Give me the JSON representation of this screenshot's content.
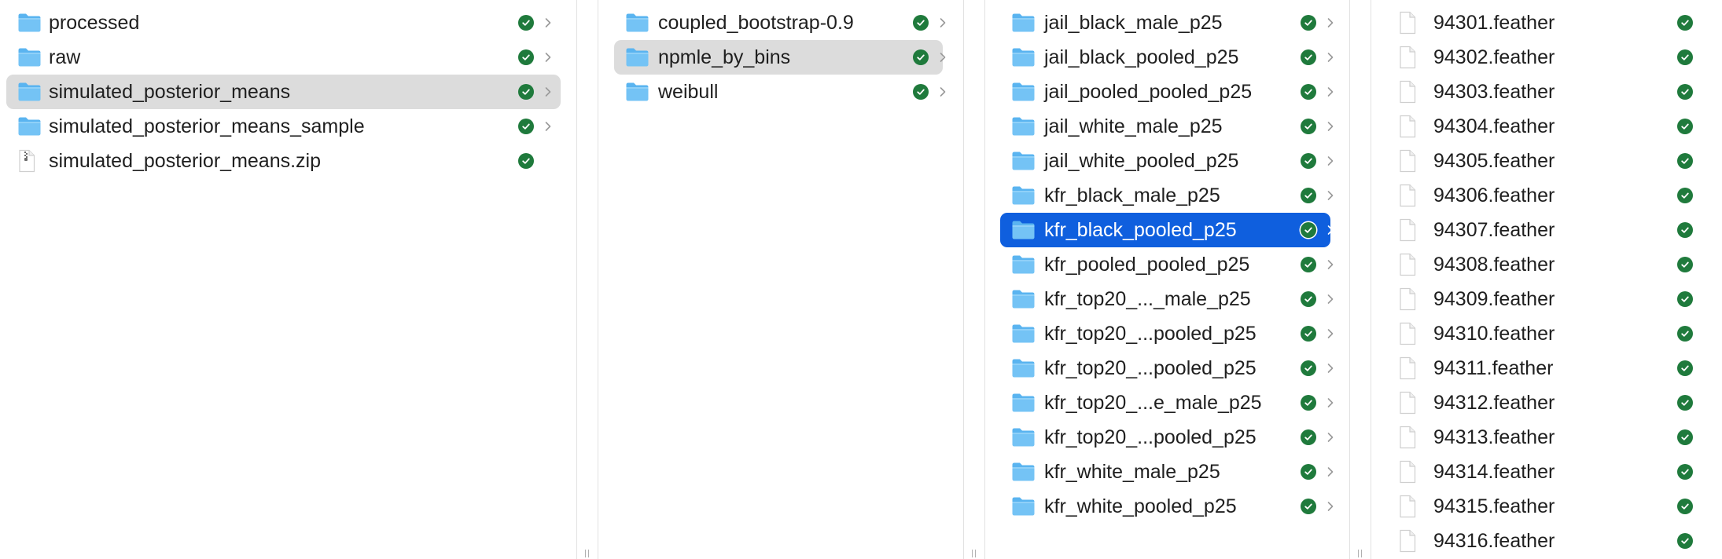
{
  "columns": [
    {
      "items": [
        {
          "label": "processed",
          "type": "folder",
          "state": "normal",
          "icon": "folder-icon",
          "status": "synced"
        },
        {
          "label": "raw",
          "type": "folder",
          "state": "normal",
          "icon": "folder-icon",
          "status": "synced"
        },
        {
          "label": "simulated_posterior_means",
          "type": "folder",
          "state": "highlighted",
          "icon": "folder-icon",
          "status": "synced"
        },
        {
          "label": "simulated_posterior_means_sample",
          "type": "folder",
          "state": "normal",
          "icon": "folder-icon",
          "status": "synced"
        },
        {
          "label": "simulated_posterior_means.zip",
          "type": "zip",
          "state": "normal",
          "icon": "zip-file-icon",
          "status": "synced"
        }
      ]
    },
    {
      "items": [
        {
          "label": "coupled_bootstrap-0.9",
          "type": "folder",
          "state": "normal",
          "icon": "folder-icon",
          "status": "synced"
        },
        {
          "label": "npmle_by_bins",
          "type": "folder",
          "state": "highlighted",
          "icon": "folder-icon",
          "status": "synced"
        },
        {
          "label": "weibull",
          "type": "folder",
          "state": "normal",
          "icon": "folder-icon",
          "status": "synced"
        }
      ]
    },
    {
      "items": [
        {
          "label": "jail_black_male_p25",
          "type": "folder",
          "state": "normal",
          "icon": "folder-icon",
          "status": "synced"
        },
        {
          "label": "jail_black_pooled_p25",
          "type": "folder",
          "state": "normal",
          "icon": "folder-icon",
          "status": "synced"
        },
        {
          "label": "jail_pooled_pooled_p25",
          "type": "folder",
          "state": "normal",
          "icon": "folder-icon",
          "status": "synced"
        },
        {
          "label": "jail_white_male_p25",
          "type": "folder",
          "state": "normal",
          "icon": "folder-icon",
          "status": "synced"
        },
        {
          "label": "jail_white_pooled_p25",
          "type": "folder",
          "state": "normal",
          "icon": "folder-icon",
          "status": "synced"
        },
        {
          "label": "kfr_black_male_p25",
          "type": "folder",
          "state": "normal",
          "icon": "folder-icon",
          "status": "synced"
        },
        {
          "label": "kfr_black_pooled_p25",
          "type": "folder",
          "state": "selected",
          "icon": "folder-icon",
          "status": "synced"
        },
        {
          "label": "kfr_pooled_pooled_p25",
          "type": "folder",
          "state": "normal",
          "icon": "folder-icon",
          "status": "synced"
        },
        {
          "label": "kfr_top20_..._male_p25",
          "type": "folder",
          "state": "normal",
          "icon": "folder-icon",
          "status": "synced"
        },
        {
          "label": "kfr_top20_...pooled_p25",
          "type": "folder",
          "state": "normal",
          "icon": "folder-icon",
          "status": "synced"
        },
        {
          "label": "kfr_top20_...pooled_p25",
          "type": "folder",
          "state": "normal",
          "icon": "folder-icon",
          "status": "synced"
        },
        {
          "label": "kfr_top20_...e_male_p25",
          "type": "folder",
          "state": "normal",
          "icon": "folder-icon",
          "status": "synced"
        },
        {
          "label": "kfr_top20_...pooled_p25",
          "type": "folder",
          "state": "normal",
          "icon": "folder-icon",
          "status": "synced"
        },
        {
          "label": "kfr_white_male_p25",
          "type": "folder",
          "state": "normal",
          "icon": "folder-icon",
          "status": "synced"
        },
        {
          "label": "kfr_white_pooled_p25",
          "type": "folder",
          "state": "normal",
          "icon": "folder-icon",
          "status": "synced"
        }
      ]
    },
    {
      "items": [
        {
          "label": "94301.feather",
          "type": "file",
          "state": "normal",
          "icon": "document-icon",
          "status": "synced"
        },
        {
          "label": "94302.feather",
          "type": "file",
          "state": "normal",
          "icon": "document-icon",
          "status": "synced"
        },
        {
          "label": "94303.feather",
          "type": "file",
          "state": "normal",
          "icon": "document-icon",
          "status": "synced"
        },
        {
          "label": "94304.feather",
          "type": "file",
          "state": "normal",
          "icon": "document-icon",
          "status": "synced"
        },
        {
          "label": "94305.feather",
          "type": "file",
          "state": "normal",
          "icon": "document-icon",
          "status": "synced"
        },
        {
          "label": "94306.feather",
          "type": "file",
          "state": "normal",
          "icon": "document-icon",
          "status": "synced"
        },
        {
          "label": "94307.feather",
          "type": "file",
          "state": "normal",
          "icon": "document-icon",
          "status": "synced"
        },
        {
          "label": "94308.feather",
          "type": "file",
          "state": "normal",
          "icon": "document-icon",
          "status": "synced"
        },
        {
          "label": "94309.feather",
          "type": "file",
          "state": "normal",
          "icon": "document-icon",
          "status": "synced"
        },
        {
          "label": "94310.feather",
          "type": "file",
          "state": "normal",
          "icon": "document-icon",
          "status": "synced"
        },
        {
          "label": "94311.feather",
          "type": "file",
          "state": "normal",
          "icon": "document-icon",
          "status": "synced"
        },
        {
          "label": "94312.feather",
          "type": "file",
          "state": "normal",
          "icon": "document-icon",
          "status": "synced"
        },
        {
          "label": "94313.feather",
          "type": "file",
          "state": "normal",
          "icon": "document-icon",
          "status": "synced"
        },
        {
          "label": "94314.feather",
          "type": "file",
          "state": "normal",
          "icon": "document-icon",
          "status": "synced"
        },
        {
          "label": "94315.feather",
          "type": "file",
          "state": "normal",
          "icon": "document-icon",
          "status": "synced"
        },
        {
          "label": "94316.feather",
          "type": "file",
          "state": "normal",
          "icon": "document-icon",
          "status": "synced"
        }
      ]
    }
  ],
  "colors": {
    "selection": "#0f5fde",
    "highlight": "#dcdcdc",
    "folder": "#5ab4f0",
    "synced_badge": "#1f7a3c"
  }
}
